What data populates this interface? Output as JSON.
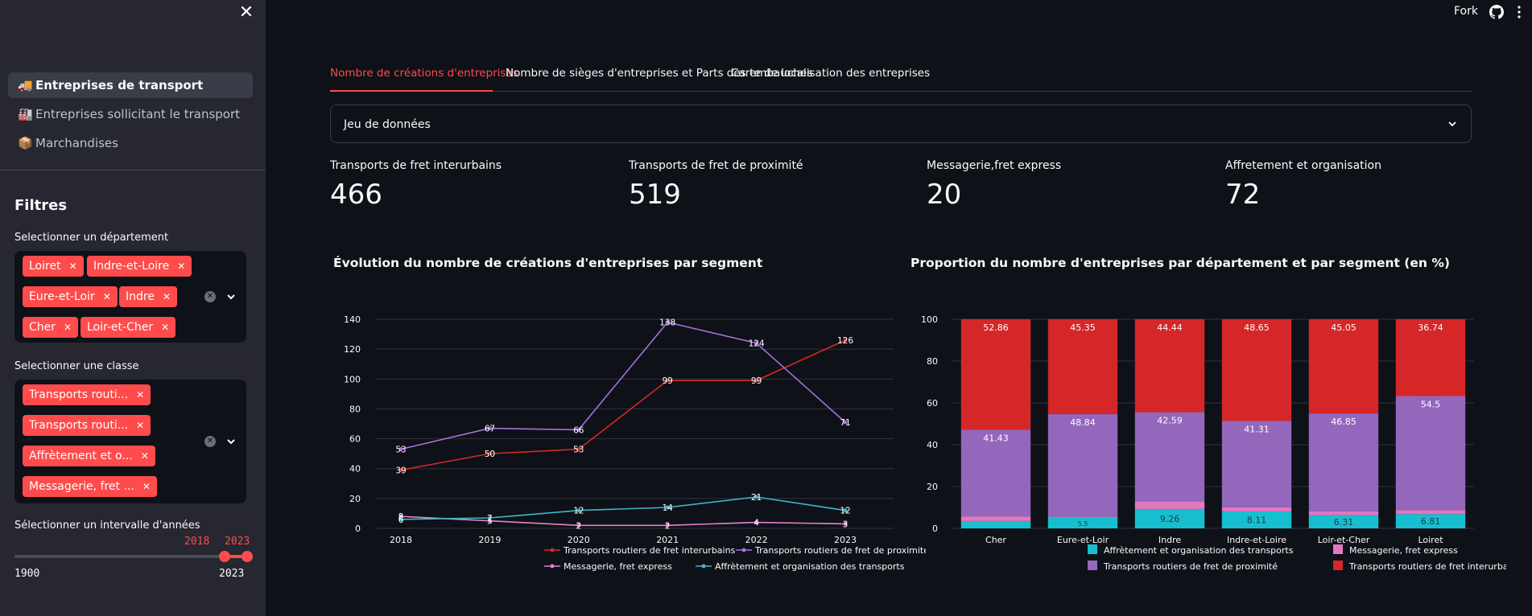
{
  "sidebar": {
    "close_icon": "close-icon",
    "nav": [
      {
        "icon": "truck-icon",
        "emoji": "🚚",
        "label": "Entreprises de transport",
        "active": true
      },
      {
        "icon": "factory-icon",
        "emoji": "🏭",
        "label": "Entreprises sollicitant le transport",
        "active": false
      },
      {
        "icon": "package-icon",
        "emoji": "📦",
        "label": "Marchandises",
        "active": false
      }
    ],
    "filters_title": "Filtres",
    "dept_label": "Selectionner un département",
    "dept_tags": [
      "Loiret",
      "Indre-et-Loire",
      "Eure-et-Loir",
      "Indre",
      "Cher",
      "Loir-et-Cher"
    ],
    "class_label": "Selectionner une classe",
    "class_tags": [
      "Transports routi...",
      "Transports routi...",
      "Affrètement et o...",
      "Messagerie, fret ..."
    ],
    "years_label": "Sélectionner un intervalle d'années",
    "years_selected": [
      "2018",
      "2023"
    ],
    "years_min": "1900",
    "years_max": "2023"
  },
  "topbar": {
    "fork_label": "Fork",
    "github_icon": "github-icon",
    "menu_icon": "kebab-menu-icon"
  },
  "tabs": [
    {
      "label": "Nombre de créations d'entreprises",
      "active": true
    },
    {
      "label": "Nombre de sièges d'entreprises et Parts des embauches",
      "active": false
    },
    {
      "label": "Carte de localisation des entreprises",
      "active": false
    }
  ],
  "expander": {
    "label": "Jeu de données"
  },
  "metrics": [
    {
      "label": "Transports de fret interurbains",
      "value": "466"
    },
    {
      "label": "Transports de fret de proximité",
      "value": "519"
    },
    {
      "label": "Messagerie,fret express",
      "value": "20"
    },
    {
      "label": "Affretement et organisation",
      "value": "72"
    }
  ],
  "colors": {
    "accent": "#ff4b4b",
    "red": "#d62728",
    "purple": "#9467bd",
    "pink": "#e377c2",
    "cyan": "#17becf",
    "purple_line": "#a86fdc",
    "cyan_line": "#3fb8c9",
    "pink_line": "#e77fd0"
  },
  "chart_data": [
    {
      "type": "line",
      "title": "Évolution du nombre de créations d'entreprises par segment",
      "x": [
        "2018",
        "2019",
        "2020",
        "2021",
        "2022",
        "2023"
      ],
      "ylim": [
        0,
        140
      ],
      "yticks": [
        0,
        20,
        40,
        60,
        80,
        100,
        120,
        140
      ],
      "series": [
        {
          "name": "Transports routiers de fret interurbains",
          "values": [
            39,
            50,
            53,
            99,
            99,
            126
          ]
        },
        {
          "name": "Transports routiers de fret de proximité",
          "values": [
            53,
            67,
            66,
            138,
            124,
            71
          ]
        },
        {
          "name": "Messagerie, fret express",
          "values": [
            8,
            5,
            2,
            2,
            4,
            3
          ]
        },
        {
          "name": "Affrètement et organisation des transports",
          "values": [
            6,
            7,
            12,
            14,
            21,
            12
          ]
        }
      ],
      "legend": "bottom"
    },
    {
      "type": "bar",
      "stacked": true,
      "title": "Proportion du nombre d'entreprises par département et par segment (en %)",
      "categories": [
        "Cher",
        "Eure-et-Loir",
        "Indre",
        "Indre-et-Loire",
        "Loir-et-Cher",
        "Loiret"
      ],
      "ylim": [
        0,
        100
      ],
      "yticks": [
        0,
        20,
        40,
        60,
        80,
        100
      ],
      "series": [
        {
          "name": "Affrètement et organisation des transports",
          "values": [
            3.5,
            5.5,
            9.26,
            8.11,
            6.31,
            6.81
          ],
          "labels": [
            "",
            "5.5",
            "9.26",
            "8.11",
            "6.31",
            "6.81"
          ]
        },
        {
          "name": "Messagerie, fret express",
          "values": [
            2.21,
            0.31,
            3.71,
            1.93,
            1.79,
            1.95
          ],
          "labels": [
            "",
            "",
            "",
            "",
            "",
            ""
          ]
        },
        {
          "name": "Transports routiers de fret de proximité",
          "values": [
            41.43,
            48.84,
            42.59,
            41.31,
            46.85,
            54.5
          ],
          "labels": [
            "41.43",
            "48.84",
            "42.59",
            "41.31",
            "46.85",
            "54.5"
          ]
        },
        {
          "name": "Transports routiers de fret interurbains",
          "values": [
            52.86,
            45.35,
            44.44,
            48.65,
            45.05,
            36.74
          ],
          "labels": [
            "52.86",
            "45.35",
            "44.44",
            "48.65",
            "45.05",
            "36.74"
          ]
        }
      ],
      "legend": "bottom"
    }
  ]
}
